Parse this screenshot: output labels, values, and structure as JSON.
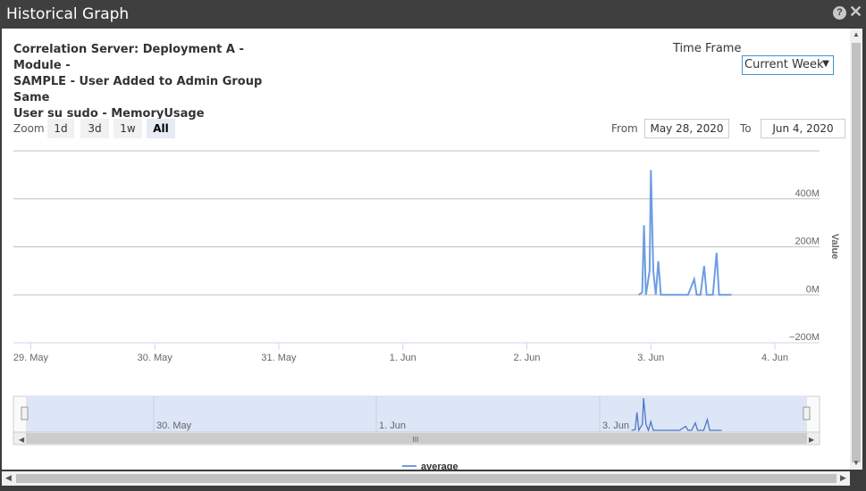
{
  "window": {
    "title": "Historical Graph",
    "help_icon": "question-circle-icon",
    "close_icon": "close-icon"
  },
  "header": {
    "chart_title_lines": [
      "Correlation Server: Deployment A - Module -",
      "SAMPLE - User Added to Admin Group Same",
      "User su sudo - MemoryUsage"
    ],
    "time_frame_label": "Time Frame",
    "time_frame_value": "Current Week"
  },
  "controls": {
    "zoom_label": "Zoom",
    "zoom_buttons": [
      "1d",
      "3d",
      "1w",
      "All"
    ],
    "active_zoom": "All",
    "from_label": "From",
    "from_value": "May 28, 2020",
    "to_label": "To",
    "to_value": "Jun 4, 2020"
  },
  "navigator": {
    "labels": [
      "30. May",
      "1. Jun",
      "3. Jun"
    ],
    "grip_label": "III"
  },
  "colors": {
    "series": "#6d9de2",
    "grid": "#c0c0c0",
    "navigator_fill": "#dce6f7"
  },
  "chart_data": {
    "type": "line",
    "ylabel": "Value",
    "y_tick_labels": [
      "−200M",
      "0M",
      "200M",
      "400M"
    ],
    "y_ticks": [
      -200,
      0,
      200,
      400
    ],
    "ylim": [
      -200,
      600
    ],
    "x_tick_labels": [
      "29. May",
      "30. May",
      "31. May",
      "1. Jun",
      "2. Jun",
      "3. Jun",
      "4. Jun"
    ],
    "x_tick_days": [
      0,
      1,
      2,
      3,
      4,
      5,
      6
    ],
    "xlim_days": [
      -0.14,
      6.36
    ],
    "grid": true,
    "legend": "bottom-center",
    "series": [
      {
        "name": "average",
        "x_days": [
          4.9,
          4.93,
          4.945,
          4.96,
          4.99,
          5.0,
          5.02,
          5.04,
          5.06,
          5.08,
          5.1,
          5.3,
          5.35,
          5.37,
          5.4,
          5.43,
          5.45,
          5.47,
          5.5,
          5.53,
          5.55,
          5.57,
          5.6,
          5.65
        ],
        "y_values": [
          0,
          10,
          290,
          0,
          100,
          520,
          100,
          0,
          140,
          0,
          0,
          0,
          65,
          0,
          0,
          120,
          0,
          0,
          0,
          175,
          0,
          0,
          0,
          0
        ]
      }
    ]
  }
}
